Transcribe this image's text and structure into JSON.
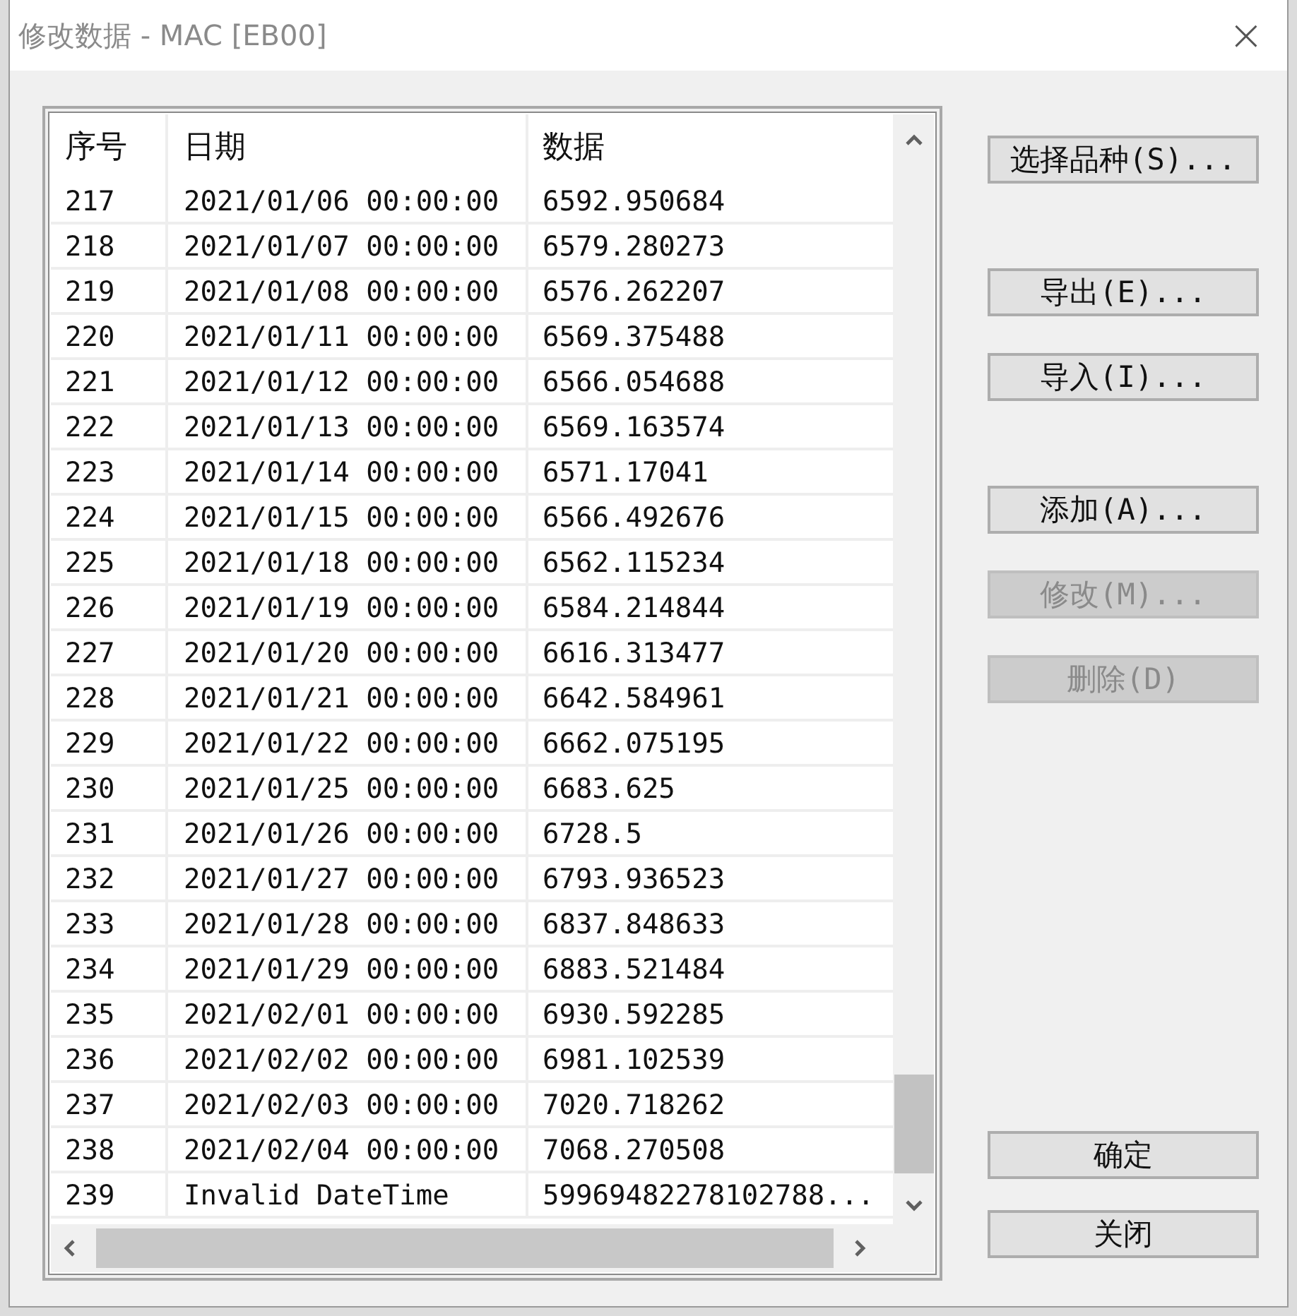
{
  "window": {
    "title": "修改数据 - MAC [EB00]",
    "close": "×"
  },
  "table": {
    "columns": [
      "序号",
      "日期",
      "数据"
    ],
    "rows": [
      [
        "217",
        "2021/01/06 00:00:00",
        "6592.950684"
      ],
      [
        "218",
        "2021/01/07 00:00:00",
        "6579.280273"
      ],
      [
        "219",
        "2021/01/08 00:00:00",
        "6576.262207"
      ],
      [
        "220",
        "2021/01/11 00:00:00",
        "6569.375488"
      ],
      [
        "221",
        "2021/01/12 00:00:00",
        "6566.054688"
      ],
      [
        "222",
        "2021/01/13 00:00:00",
        "6569.163574"
      ],
      [
        "223",
        "2021/01/14 00:00:00",
        "6571.17041"
      ],
      [
        "224",
        "2021/01/15 00:00:00",
        "6566.492676"
      ],
      [
        "225",
        "2021/01/18 00:00:00",
        "6562.115234"
      ],
      [
        "226",
        "2021/01/19 00:00:00",
        "6584.214844"
      ],
      [
        "227",
        "2021/01/20 00:00:00",
        "6616.313477"
      ],
      [
        "228",
        "2021/01/21 00:00:00",
        "6642.584961"
      ],
      [
        "229",
        "2021/01/22 00:00:00",
        "6662.075195"
      ],
      [
        "230",
        "2021/01/25 00:00:00",
        "6683.625"
      ],
      [
        "231",
        "2021/01/26 00:00:00",
        "6728.5"
      ],
      [
        "232",
        "2021/01/27 00:00:00",
        "6793.936523"
      ],
      [
        "233",
        "2021/01/28 00:00:00",
        "6837.848633"
      ],
      [
        "234",
        "2021/01/29 00:00:00",
        "6883.521484"
      ],
      [
        "235",
        "2021/02/01 00:00:00",
        "6930.592285"
      ],
      [
        "236",
        "2021/02/02 00:00:00",
        "6981.102539"
      ],
      [
        "237",
        "2021/02/03 00:00:00",
        "7020.718262"
      ],
      [
        "238",
        "2021/02/04 00:00:00",
        "7068.270508"
      ],
      [
        "239",
        "Invalid DateTime",
        "59969482278102788..."
      ]
    ]
  },
  "button_groups": [
    [
      {
        "label": "选择品种(S)...",
        "disabled": false
      }
    ],
    [
      {
        "label": "导出(E)...",
        "disabled": false
      },
      {
        "label": "导入(I)...",
        "disabled": false
      }
    ],
    [
      {
        "label": "添加(A)...",
        "disabled": false
      },
      {
        "label": "修改(M)...",
        "disabled": true
      },
      {
        "label": "删除(D)",
        "disabled": true
      }
    ],
    [
      {
        "label": "确定",
        "disabled": false
      },
      {
        "label": "关闭",
        "disabled": false
      }
    ]
  ]
}
